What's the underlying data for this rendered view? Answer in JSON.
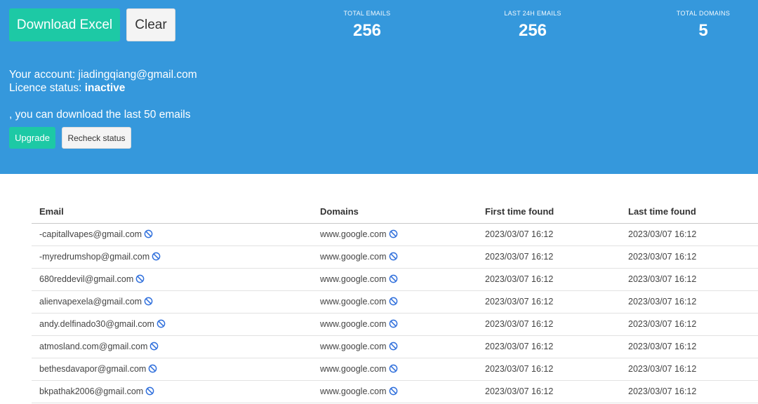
{
  "actions": {
    "download_label": "Download Excel",
    "clear_label": "Clear",
    "upgrade_label": "Upgrade",
    "recheck_label": "Recheck status"
  },
  "stats": {
    "total_emails_label": "TOTAL EMAILS",
    "total_emails_value": "256",
    "last24h_label": "LAST 24H EMAILS",
    "last24h_value": "256",
    "total_domains_label": "TOTAL DOMAINS",
    "total_domains_value": "5"
  },
  "account": {
    "account_prefix": "Your account: ",
    "email": "jiadingqiang@gmail.com",
    "licence_prefix": "Licence status: ",
    "licence_status": "inactive",
    "download_note": ", you can download the last 50 emails"
  },
  "colors": {
    "hero_bg": "#3598dc",
    "accent": "#1dc9a5",
    "block_icon": "#2f6fdc"
  },
  "icons": {
    "row_action": "block-icon"
  },
  "table": {
    "headers": {
      "email": "Email",
      "domains": "Domains",
      "first": "First time found",
      "last": "Last time found"
    },
    "rows": [
      {
        "email": "-capitallvapes@gmail.com",
        "domain": "www.google.com",
        "first": "2023/03/07 16:12",
        "last": "2023/03/07 16:12"
      },
      {
        "email": "-myredrumshop@gmail.com",
        "domain": "www.google.com",
        "first": "2023/03/07 16:12",
        "last": "2023/03/07 16:12"
      },
      {
        "email": "680reddevil@gmail.com",
        "domain": "www.google.com",
        "first": "2023/03/07 16:12",
        "last": "2023/03/07 16:12"
      },
      {
        "email": "alienvapexela@gmail.com",
        "domain": "www.google.com",
        "first": "2023/03/07 16:12",
        "last": "2023/03/07 16:12"
      },
      {
        "email": "andy.delfinado30@gmail.com",
        "domain": "www.google.com",
        "first": "2023/03/07 16:12",
        "last": "2023/03/07 16:12"
      },
      {
        "email": "atmosland.com@gmail.com",
        "domain": "www.google.com",
        "first": "2023/03/07 16:12",
        "last": "2023/03/07 16:12"
      },
      {
        "email": "bethesdavapor@gmail.com",
        "domain": "www.google.com",
        "first": "2023/03/07 16:12",
        "last": "2023/03/07 16:12"
      },
      {
        "email": "bkpathak2006@gmail.com",
        "domain": "www.google.com",
        "first": "2023/03/07 16:12",
        "last": "2023/03/07 16:12"
      }
    ]
  }
}
